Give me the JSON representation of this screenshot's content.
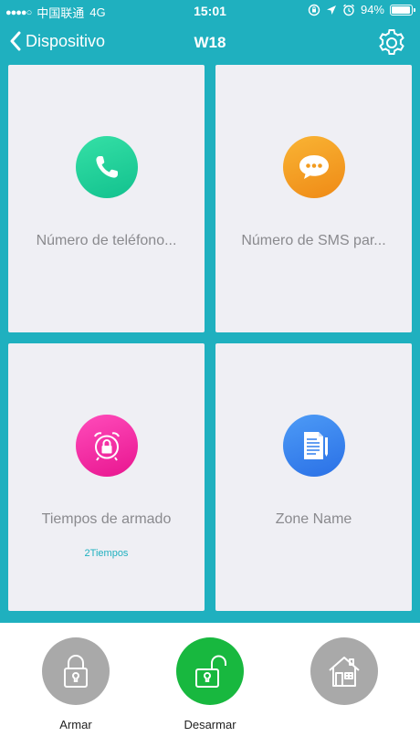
{
  "status_bar": {
    "carrier": "中国联通",
    "network": "4G",
    "time": "15:01",
    "battery": "94%",
    "battery_level": 0.94
  },
  "nav": {
    "back_label": "Dispositivo",
    "title": "W18",
    "icons": {
      "back": "chevron-left-icon",
      "settings": "gear-icon"
    }
  },
  "cards": {
    "phone": {
      "label": "Número de teléfono...",
      "icon": "phone-icon"
    },
    "sms": {
      "label": "Número de SMS par...",
      "icon": "chat-bubble-icon"
    },
    "arm_times": {
      "label": "Tiempos de armado",
      "sub": "2Tiempos",
      "icon": "alarm-clock-lock-icon"
    },
    "zone": {
      "label": "Zone Name",
      "icon": "document-edit-icon"
    }
  },
  "actions": {
    "arm": {
      "label": "Armar",
      "icon": "lock-closed-icon"
    },
    "disarm": {
      "label": "Desarmar",
      "icon": "lock-open-icon"
    },
    "home": {
      "label": "",
      "icon": "home-icon"
    }
  },
  "colors": {
    "accent": "#1fb0bf",
    "card_bg": "#efeff4",
    "phone": "#17c994",
    "sms": "#f29b1f",
    "arm_times": "#f026a5",
    "zone": "#3c86ef",
    "disarm_active": "#18b83f",
    "inactive": "#a9a9a9"
  }
}
